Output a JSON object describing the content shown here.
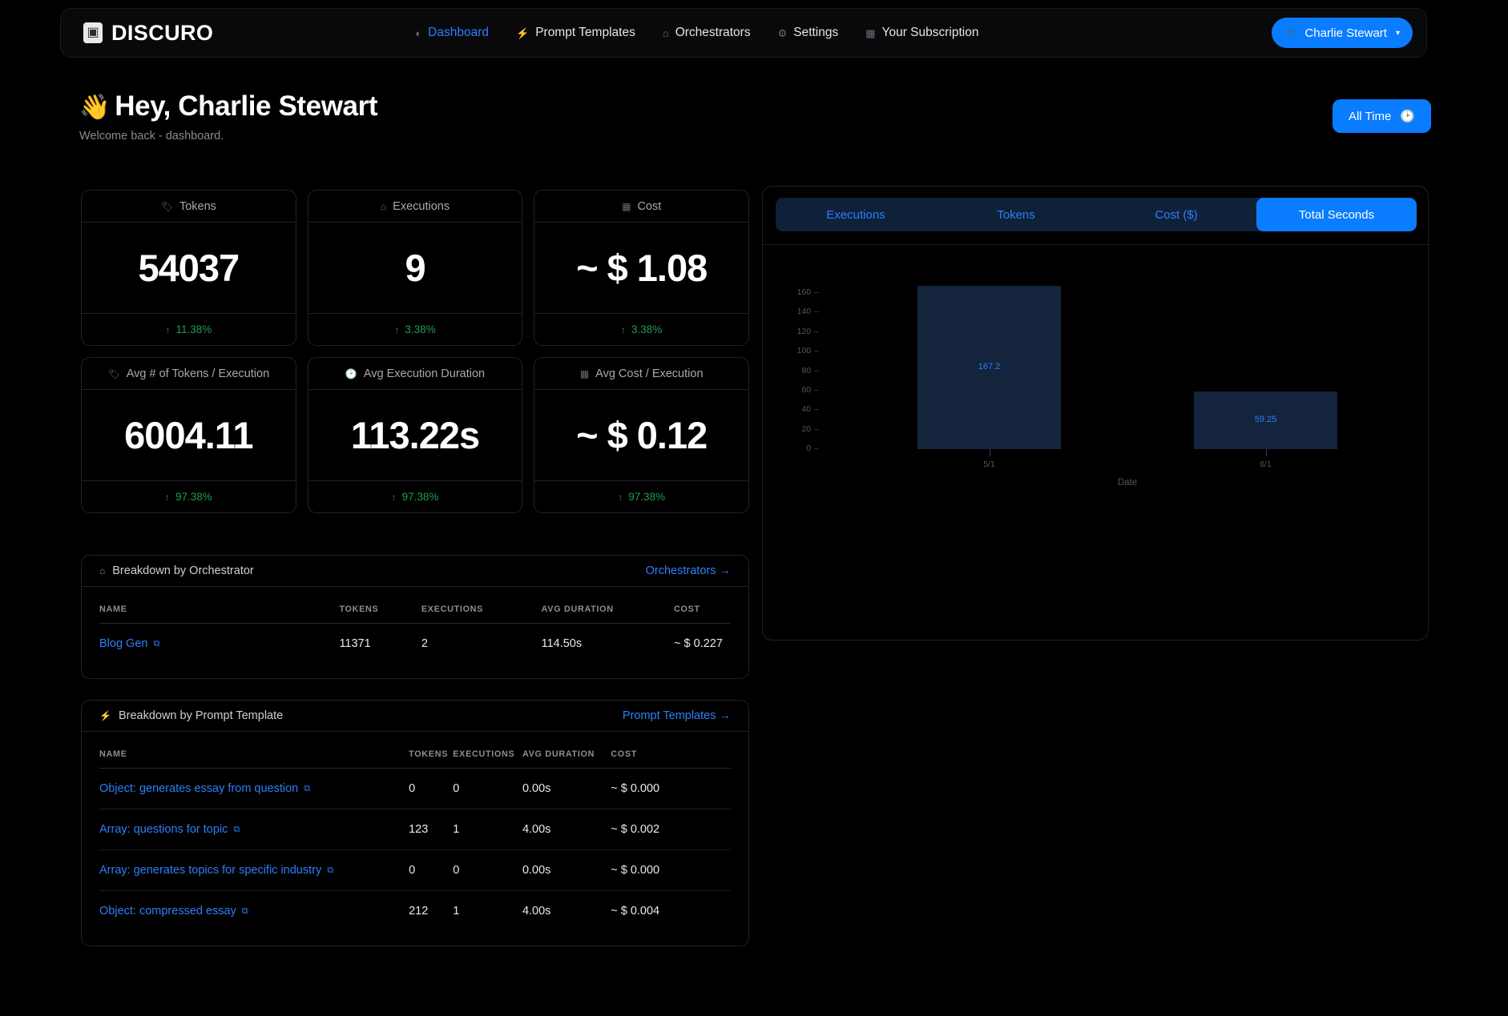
{
  "navbar": {
    "brand": "DISCURO",
    "brand_icon": "puzzle-icon",
    "links": [
      {
        "label": "Dashboard",
        "icon": "pie-chart-icon",
        "active": true
      },
      {
        "label": "Prompt Templates",
        "icon": "lightning-icon",
        "active": false
      },
      {
        "label": "Orchestrators",
        "icon": "branch-icon",
        "active": false
      },
      {
        "label": "Settings",
        "icon": "gear-icon",
        "active": false
      },
      {
        "label": "Your Subscription",
        "icon": "card-icon",
        "active": false
      }
    ],
    "user_button": {
      "label": "Charlie Stewart",
      "icon": "person-icon",
      "caret": "▾"
    }
  },
  "header": {
    "wave": "👋",
    "title": "Hey, Charlie Stewart",
    "subtitle": "Welcome back - dashboard.",
    "range_button": {
      "label": "All Time",
      "icon": "clock-icon"
    }
  },
  "stats": [
    {
      "icon": "tag-icon",
      "label": "Tokens",
      "value": "54037",
      "delta": "11.38%",
      "arrow": "↑"
    },
    {
      "icon": "branch-icon",
      "label": "Executions",
      "value": "9",
      "delta": "3.38%",
      "arrow": "↑"
    },
    {
      "icon": "card-icon",
      "label": "Cost",
      "value": "~ $ 1.08",
      "delta": "3.38%",
      "arrow": "↑"
    },
    {
      "icon": "tag-icon",
      "label": "Avg # of Tokens / Execution",
      "value": "6004.11",
      "delta": "97.38%",
      "arrow": "↑"
    },
    {
      "icon": "clock-icon",
      "label": "Avg Execution Duration",
      "value": "113.22s",
      "delta": "97.38%",
      "arrow": "↑"
    },
    {
      "icon": "card-icon",
      "label": "Avg Cost / Execution",
      "value": "~ $ 0.12",
      "delta": "97.38%",
      "arrow": "↑"
    }
  ],
  "orchestrator_panel": {
    "icon": "branch-icon",
    "title": "Breakdown by Orchestrator",
    "link": "Orchestrators  →",
    "columns": [
      "NAME",
      "TOKENS",
      "EXECUTIONS",
      "AVG DURATION",
      "COST"
    ],
    "rows": [
      {
        "name": "Blog Gen",
        "tokens": "11371",
        "executions": "2",
        "avg_duration": "114.50s",
        "cost": "~ $ 0.227"
      }
    ]
  },
  "template_panel": {
    "icon": "lightning-icon",
    "title": "Breakdown by Prompt Template",
    "link": "Prompt Templates  →",
    "columns": [
      "NAME",
      "TOKENS",
      "EXECUTIONS",
      "AVG DURATION",
      "COST"
    ],
    "rows": [
      {
        "name": "Object: generates essay from question",
        "tokens": "0",
        "executions": "0",
        "avg_duration": "0.00s",
        "cost": "~ $ 0.000"
      },
      {
        "name": "Array: questions for topic",
        "tokens": "123",
        "executions": "1",
        "avg_duration": "4.00s",
        "cost": "~ $ 0.002"
      },
      {
        "name": "Array: generates topics for specific industry",
        "tokens": "0",
        "executions": "0",
        "avg_duration": "0.00s",
        "cost": "~ $ 0.000"
      },
      {
        "name": "Object: compressed essay",
        "tokens": "212",
        "executions": "1",
        "avg_duration": "4.00s",
        "cost": "~ $ 0.004"
      }
    ]
  },
  "chart_panel": {
    "tabs": [
      {
        "label": "Executions",
        "active": false
      },
      {
        "label": "Tokens",
        "active": false
      },
      {
        "label": "Cost ($)",
        "active": false
      },
      {
        "label": "Total Seconds",
        "active": true
      }
    ]
  },
  "chart_data": {
    "type": "bar",
    "title": "",
    "xlabel": "Date",
    "ylabel": "",
    "categories": [
      "5/1",
      "6/1"
    ],
    "values": [
      167.2,
      59.25
    ],
    "data_labels": [
      "167.2",
      "59.25"
    ],
    "ylim": [
      0,
      170
    ],
    "yticks": [
      0,
      20,
      40,
      60,
      80,
      100,
      120,
      140,
      160
    ],
    "ytick_labels": [
      "0",
      "20",
      "40",
      "60",
      "80",
      "100",
      "120",
      "140",
      "160"
    ],
    "grid": false,
    "legend": false,
    "bar_color": "#13243c",
    "label_color": "#2d7ff9"
  },
  "colors": {
    "accent": "#0a7cff",
    "link": "#2d7ff9",
    "positive": "#1f9e4e",
    "background": "#000000",
    "panel_border": "#222226"
  }
}
